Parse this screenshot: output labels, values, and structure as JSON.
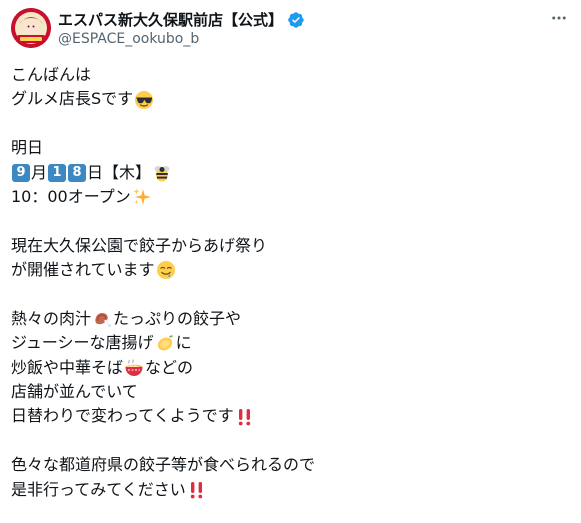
{
  "account": {
    "display_name": "エスパス新大久保駅前店【公式】",
    "handle": "@ESPACE_ookubo_b"
  },
  "post": {
    "l1": "こんばんは",
    "l2": "グルメ店長Sです",
    "l4": "明日",
    "date": {
      "d1": "9",
      "m": "月",
      "d2": "1",
      "d3": "8",
      "rest": "日【木】"
    },
    "l6": "10：00オープン",
    "l8": "現在大久保公園で餃子からあげ祭り",
    "l9": "が開催されています",
    "l11a": "熱々の肉汁",
    "l11b": "たっぷりの餃子や",
    "l12a": "ジューシーな唐揚げ",
    "l12b": "に",
    "l13a": "炒飯や中華そば",
    "l13b": "などの",
    "l14": "店舗が並んでいて",
    "l15": "日替わりで変わってくようです",
    "l17": "色々な都道府県の餃子等が食べられるので",
    "l18": "是非行ってみてください"
  },
  "icons": {
    "sunglasses": "sunglasses-face-emoji",
    "bee": "bee-emoji",
    "sparkles": "sparkles-emoji",
    "drooling": "drooling-face-emoji",
    "meat": "meat-on-bone-emoji",
    "lemon": "lemon-emoji",
    "noodles": "steaming-bowl-emoji",
    "exclaim": "double-exclamation-emoji",
    "verified": "verified-badge-icon",
    "more": "more-options-icon"
  },
  "colors": {
    "text": "#0f1419",
    "secondary": "#536471",
    "verified": "#1d9bf0",
    "keycap": "#3b88c3"
  }
}
